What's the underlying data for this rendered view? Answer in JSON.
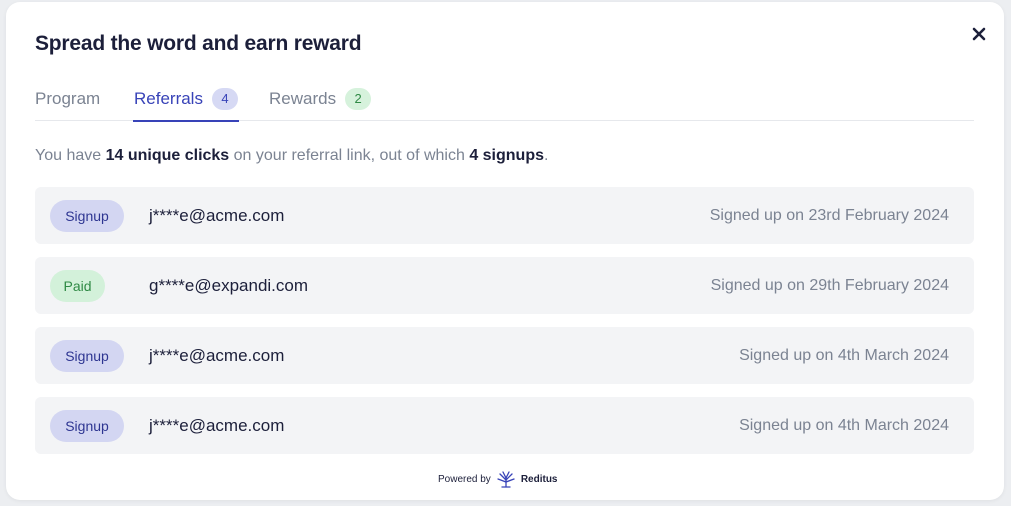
{
  "dialog": {
    "title": "Spread the word and earn reward",
    "close_icon": "close-icon"
  },
  "tabs": [
    {
      "label": "Program",
      "count": null,
      "active": false
    },
    {
      "label": "Referrals",
      "count": "4",
      "active": true
    },
    {
      "label": "Rewards",
      "count": "2",
      "active": false
    }
  ],
  "summary": {
    "prefix": "You have ",
    "clicks": "14 unique clicks",
    "middle": " on your referral link, out of which ",
    "signups": "4 signups",
    "suffix": "."
  },
  "referrals": [
    {
      "status": "Signup",
      "email": "j****e@acme.com",
      "date": "Signed up on 23rd February 2024"
    },
    {
      "status": "Paid",
      "email": "g****e@expandi.com",
      "date": "Signed up on 29th February 2024"
    },
    {
      "status": "Signup",
      "email": "j****e@acme.com",
      "date": "Signed up on 4th March 2024"
    },
    {
      "status": "Signup",
      "email": "j****e@acme.com",
      "date": "Signed up on 4th March 2024"
    }
  ],
  "footer": {
    "powered_by": "Powered by",
    "brand": "Reditus",
    "logo_icon": "reditus-logo-icon"
  },
  "colors": {
    "accent": "#3843b8",
    "signup_badge_bg": "#d3d6f2",
    "paid_badge_bg": "#d3f1da",
    "paid_text": "#2f8a45"
  }
}
